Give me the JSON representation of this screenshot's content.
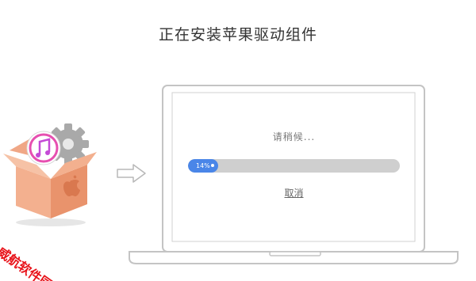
{
  "header": {
    "title": "正在安装苹果驱动组件"
  },
  "installer": {
    "wait_text": "请稍候...",
    "progress_value": 0.14,
    "progress_label": "14%",
    "cancel_label": "取消"
  },
  "watermark": {
    "text": "威航软件园"
  },
  "colors": {
    "accent": "#4a86e8",
    "track": "#cfcfcf",
    "watermark": "#e8131a"
  }
}
